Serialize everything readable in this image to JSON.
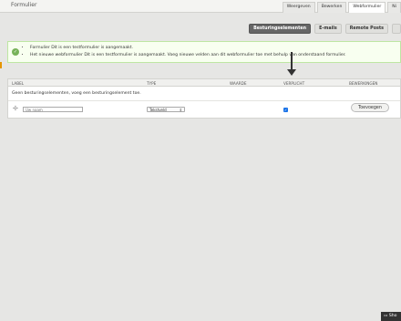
{
  "topbar": {
    "title": "Formulier",
    "tabs": [
      "Weergeven",
      "Bewerken",
      "Webformulier",
      "Ni"
    ],
    "active_tab": "Webformulier"
  },
  "subtabs": [
    "Besturingselementen",
    "E-mails",
    "Remote Posts"
  ],
  "messages": [
    "Formulier Dit is een testformulier is aangemaakt.",
    "Het nieuwe webformulier Dit is een testformulier is aangemaakt. Voeg nieuwe velden aan dit webformulier toe met behulp van onderstaand formulier."
  ],
  "table": {
    "headers": [
      "Label",
      "Type",
      "Waarde",
      "Verplicht",
      "Bewerkingen"
    ],
    "empty_text": "Geen besturingselementen, voeg een besturingselement toe.",
    "new_row": {
      "label_placeholder": "Uw naam",
      "type_value": "Tekstveld",
      "required": true,
      "add_label": "Toevoegen"
    }
  },
  "help": "Sho"
}
